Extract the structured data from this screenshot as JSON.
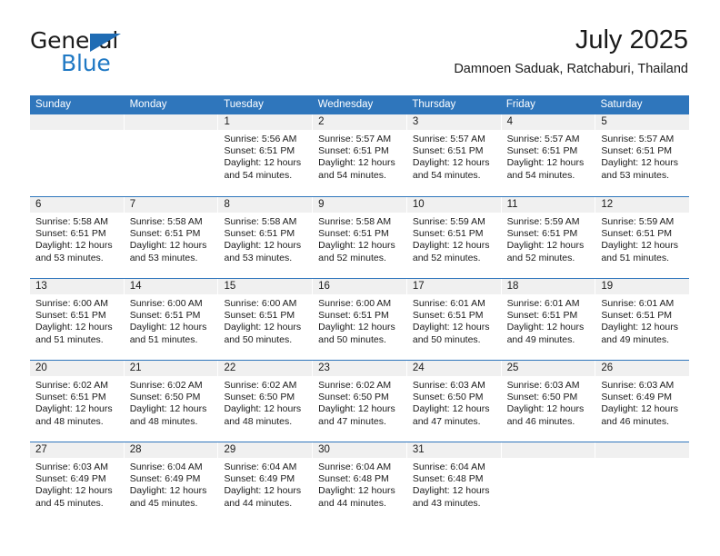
{
  "brand": {
    "name_part1": "General",
    "name_part2": "Blue",
    "triangle_icon": "brand-triangle-icon",
    "accent_color": "#2079c4"
  },
  "header": {
    "title": "July 2025",
    "subtitle": "Damnoen Saduak, Ratchaburi, Thailand"
  },
  "calendar": {
    "header_bg_color": "#2f76bc",
    "daynum_bg_color": "#f0f0f0",
    "weekdays": [
      "Sunday",
      "Monday",
      "Tuesday",
      "Wednesday",
      "Thursday",
      "Friday",
      "Saturday"
    ],
    "weeks": [
      [
        {
          "day": "",
          "sunrise": "",
          "sunset": "",
          "daylight": "",
          "empty": true
        },
        {
          "day": "",
          "sunrise": "",
          "sunset": "",
          "daylight": "",
          "empty": true
        },
        {
          "day": "1",
          "sunrise": "Sunrise: 5:56 AM",
          "sunset": "Sunset: 6:51 PM",
          "daylight": "Daylight: 12 hours and 54 minutes."
        },
        {
          "day": "2",
          "sunrise": "Sunrise: 5:57 AM",
          "sunset": "Sunset: 6:51 PM",
          "daylight": "Daylight: 12 hours and 54 minutes."
        },
        {
          "day": "3",
          "sunrise": "Sunrise: 5:57 AM",
          "sunset": "Sunset: 6:51 PM",
          "daylight": "Daylight: 12 hours and 54 minutes."
        },
        {
          "day": "4",
          "sunrise": "Sunrise: 5:57 AM",
          "sunset": "Sunset: 6:51 PM",
          "daylight": "Daylight: 12 hours and 54 minutes."
        },
        {
          "day": "5",
          "sunrise": "Sunrise: 5:57 AM",
          "sunset": "Sunset: 6:51 PM",
          "daylight": "Daylight: 12 hours and 53 minutes."
        }
      ],
      [
        {
          "day": "6",
          "sunrise": "Sunrise: 5:58 AM",
          "sunset": "Sunset: 6:51 PM",
          "daylight": "Daylight: 12 hours and 53 minutes."
        },
        {
          "day": "7",
          "sunrise": "Sunrise: 5:58 AM",
          "sunset": "Sunset: 6:51 PM",
          "daylight": "Daylight: 12 hours and 53 minutes."
        },
        {
          "day": "8",
          "sunrise": "Sunrise: 5:58 AM",
          "sunset": "Sunset: 6:51 PM",
          "daylight": "Daylight: 12 hours and 53 minutes."
        },
        {
          "day": "9",
          "sunrise": "Sunrise: 5:58 AM",
          "sunset": "Sunset: 6:51 PM",
          "daylight": "Daylight: 12 hours and 52 minutes."
        },
        {
          "day": "10",
          "sunrise": "Sunrise: 5:59 AM",
          "sunset": "Sunset: 6:51 PM",
          "daylight": "Daylight: 12 hours and 52 minutes."
        },
        {
          "day": "11",
          "sunrise": "Sunrise: 5:59 AM",
          "sunset": "Sunset: 6:51 PM",
          "daylight": "Daylight: 12 hours and 52 minutes."
        },
        {
          "day": "12",
          "sunrise": "Sunrise: 5:59 AM",
          "sunset": "Sunset: 6:51 PM",
          "daylight": "Daylight: 12 hours and 51 minutes."
        }
      ],
      [
        {
          "day": "13",
          "sunrise": "Sunrise: 6:00 AM",
          "sunset": "Sunset: 6:51 PM",
          "daylight": "Daylight: 12 hours and 51 minutes."
        },
        {
          "day": "14",
          "sunrise": "Sunrise: 6:00 AM",
          "sunset": "Sunset: 6:51 PM",
          "daylight": "Daylight: 12 hours and 51 minutes."
        },
        {
          "day": "15",
          "sunrise": "Sunrise: 6:00 AM",
          "sunset": "Sunset: 6:51 PM",
          "daylight": "Daylight: 12 hours and 50 minutes."
        },
        {
          "day": "16",
          "sunrise": "Sunrise: 6:00 AM",
          "sunset": "Sunset: 6:51 PM",
          "daylight": "Daylight: 12 hours and 50 minutes."
        },
        {
          "day": "17",
          "sunrise": "Sunrise: 6:01 AM",
          "sunset": "Sunset: 6:51 PM",
          "daylight": "Daylight: 12 hours and 50 minutes."
        },
        {
          "day": "18",
          "sunrise": "Sunrise: 6:01 AM",
          "sunset": "Sunset: 6:51 PM",
          "daylight": "Daylight: 12 hours and 49 minutes."
        },
        {
          "day": "19",
          "sunrise": "Sunrise: 6:01 AM",
          "sunset": "Sunset: 6:51 PM",
          "daylight": "Daylight: 12 hours and 49 minutes."
        }
      ],
      [
        {
          "day": "20",
          "sunrise": "Sunrise: 6:02 AM",
          "sunset": "Sunset: 6:51 PM",
          "daylight": "Daylight: 12 hours and 48 minutes."
        },
        {
          "day": "21",
          "sunrise": "Sunrise: 6:02 AM",
          "sunset": "Sunset: 6:50 PM",
          "daylight": "Daylight: 12 hours and 48 minutes."
        },
        {
          "day": "22",
          "sunrise": "Sunrise: 6:02 AM",
          "sunset": "Sunset: 6:50 PM",
          "daylight": "Daylight: 12 hours and 48 minutes."
        },
        {
          "day": "23",
          "sunrise": "Sunrise: 6:02 AM",
          "sunset": "Sunset: 6:50 PM",
          "daylight": "Daylight: 12 hours and 47 minutes."
        },
        {
          "day": "24",
          "sunrise": "Sunrise: 6:03 AM",
          "sunset": "Sunset: 6:50 PM",
          "daylight": "Daylight: 12 hours and 47 minutes."
        },
        {
          "day": "25",
          "sunrise": "Sunrise: 6:03 AM",
          "sunset": "Sunset: 6:50 PM",
          "daylight": "Daylight: 12 hours and 46 minutes."
        },
        {
          "day": "26",
          "sunrise": "Sunrise: 6:03 AM",
          "sunset": "Sunset: 6:49 PM",
          "daylight": "Daylight: 12 hours and 46 minutes."
        }
      ],
      [
        {
          "day": "27",
          "sunrise": "Sunrise: 6:03 AM",
          "sunset": "Sunset: 6:49 PM",
          "daylight": "Daylight: 12 hours and 45 minutes."
        },
        {
          "day": "28",
          "sunrise": "Sunrise: 6:04 AM",
          "sunset": "Sunset: 6:49 PM",
          "daylight": "Daylight: 12 hours and 45 minutes."
        },
        {
          "day": "29",
          "sunrise": "Sunrise: 6:04 AM",
          "sunset": "Sunset: 6:49 PM",
          "daylight": "Daylight: 12 hours and 44 minutes."
        },
        {
          "day": "30",
          "sunrise": "Sunrise: 6:04 AM",
          "sunset": "Sunset: 6:48 PM",
          "daylight": "Daylight: 12 hours and 44 minutes."
        },
        {
          "day": "31",
          "sunrise": "Sunrise: 6:04 AM",
          "sunset": "Sunset: 6:48 PM",
          "daylight": "Daylight: 12 hours and 43 minutes."
        },
        {
          "day": "",
          "sunrise": "",
          "sunset": "",
          "daylight": "",
          "empty": true
        },
        {
          "day": "",
          "sunrise": "",
          "sunset": "",
          "daylight": "",
          "empty": true
        }
      ]
    ]
  }
}
